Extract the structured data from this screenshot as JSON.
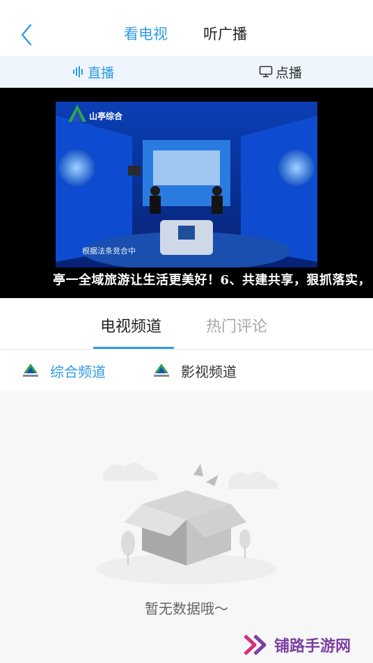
{
  "header": {
    "tabs": [
      {
        "label": "看电视",
        "active": true
      },
      {
        "label": "听广播",
        "active": false
      }
    ]
  },
  "subbar": {
    "live_label": "直播",
    "vod_label": "点播"
  },
  "video": {
    "channel_logo_text": "山亭综合",
    "subtitle": "根据法条竞合中",
    "ticker": "亭一全域旅游让生活更美好！6、共建共享，狠抓落实，"
  },
  "sections": {
    "tabs": [
      {
        "label": "电视频道",
        "active": true
      },
      {
        "label": "热门评论",
        "active": false
      }
    ]
  },
  "channels": [
    {
      "label": "综合频道",
      "active": true
    },
    {
      "label": "影视频道",
      "active": false
    }
  ],
  "empty_state": {
    "message": "暂无数据哦～"
  },
  "watermark": {
    "text": "铺路手游网"
  },
  "colors": {
    "accent": "#2e9be6",
    "subbar_bg": "#eef5fc",
    "empty_bg": "#f7f7f7",
    "watermark": "#7a3fa0"
  }
}
